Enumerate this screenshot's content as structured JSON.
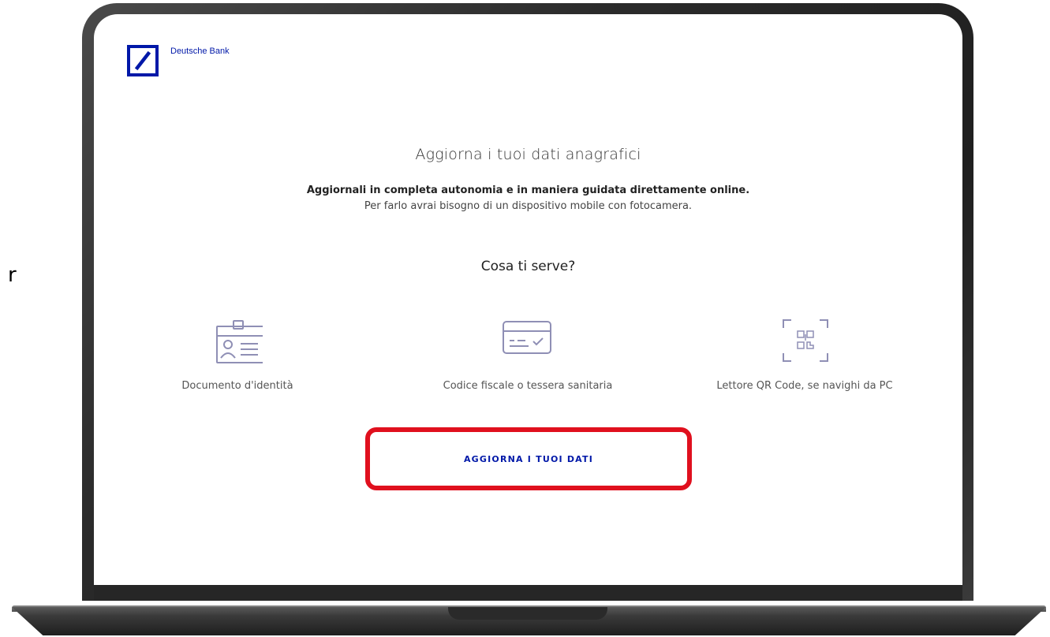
{
  "stray_text": "r",
  "brand": {
    "name": "Deutsche Bank",
    "logo_icon": "deutsche-bank-logo",
    "color": "#0018a8"
  },
  "page": {
    "title": "Aggiorna i tuoi dati anagrafici",
    "intro_strong": "Aggiornali in completa autonomia e in maniera guidata direttamente online.",
    "intro_regular": "Per farlo avrai bisogno di un dispositivo mobile con fotocamera.",
    "section_heading": "Cosa ti serve?"
  },
  "requirements": [
    {
      "icon": "id-card-icon",
      "label": "Documento d'identità"
    },
    {
      "icon": "health-card-icon",
      "label": "Codice fiscale o tessera sanitaria"
    },
    {
      "icon": "qr-code-icon",
      "label": "Lettore QR Code, se navighi da PC"
    }
  ],
  "cta": {
    "label": "AGGIORNA I TUOI DATI",
    "highlight_color": "#e0101e"
  }
}
